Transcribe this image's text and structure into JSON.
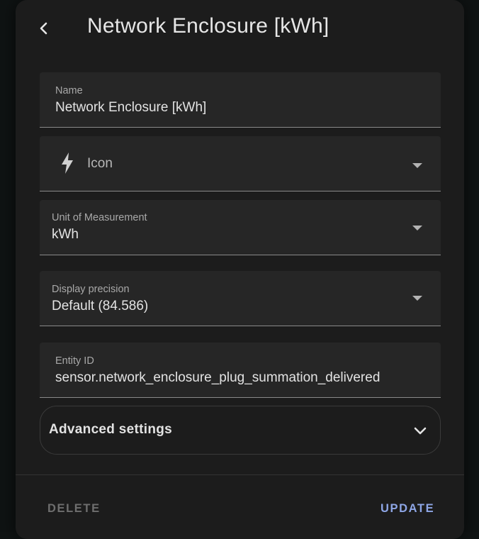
{
  "dialog": {
    "title": "Network Enclosure [kWh]"
  },
  "fields": {
    "name": {
      "label": "Name",
      "value": "Network Enclosure [kWh]"
    },
    "icon": {
      "placeholder": "Icon",
      "icon": "lightning-bolt-icon"
    },
    "unit": {
      "label": "Unit of Measurement",
      "value": "kWh"
    },
    "precision": {
      "label": "Display precision",
      "value": "Default (84.586)"
    },
    "entity_id": {
      "label": "Entity ID",
      "value": "sensor.network_enclosure_plug_summation_delivered"
    }
  },
  "advanced": {
    "label": "Advanced settings"
  },
  "actions": {
    "delete_label": "DELETE",
    "update_label": "UPDATE"
  },
  "colors": {
    "accent": "#8ea6e6",
    "surface": "#1c1c1c",
    "field_bg": "#262626"
  }
}
